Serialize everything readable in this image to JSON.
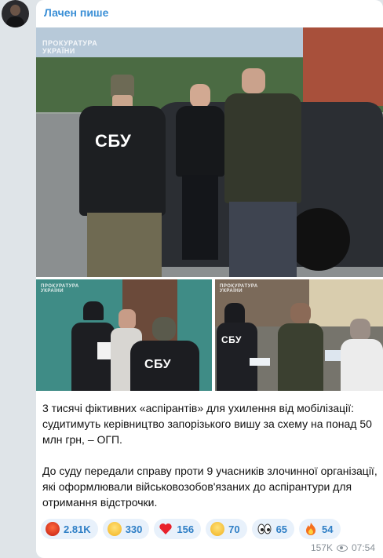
{
  "channel": {
    "name": "Лачен пише"
  },
  "photos": {
    "watermark_line1": "ПРОКУРАТУРА",
    "watermark_line2": "УКРАЇНИ",
    "badge_sbu": "СБУ"
  },
  "post": {
    "paragraph1": "3 тисячі фіктивних «аспірантів» для ухилення від мобілізації: судитимуть керівництво запорізького вишу за схему на понад 50 млн грн, – ОГП.",
    "paragraph2": "До суду передали справу проти 9 учасників злочинної організації, які оформлювали військовозобов'язаних до аспірантури для отримання відстрочки."
  },
  "reactions": [
    {
      "icon": "angry-face-icon",
      "count": "2.81K"
    },
    {
      "icon": "grinning-face-icon",
      "count": "330"
    },
    {
      "icon": "red-heart-icon",
      "count": "156"
    },
    {
      "icon": "crying-face-icon",
      "count": "70"
    },
    {
      "icon": "eyes-icon",
      "count": "65"
    },
    {
      "icon": "fire-icon",
      "count": "54"
    }
  ],
  "meta": {
    "views": "157K",
    "time": "07:54"
  },
  "colors": {
    "accent": "#3a8fd6",
    "reaction_bg": "#e8f1fb",
    "reaction_text": "#2f7fc6"
  }
}
